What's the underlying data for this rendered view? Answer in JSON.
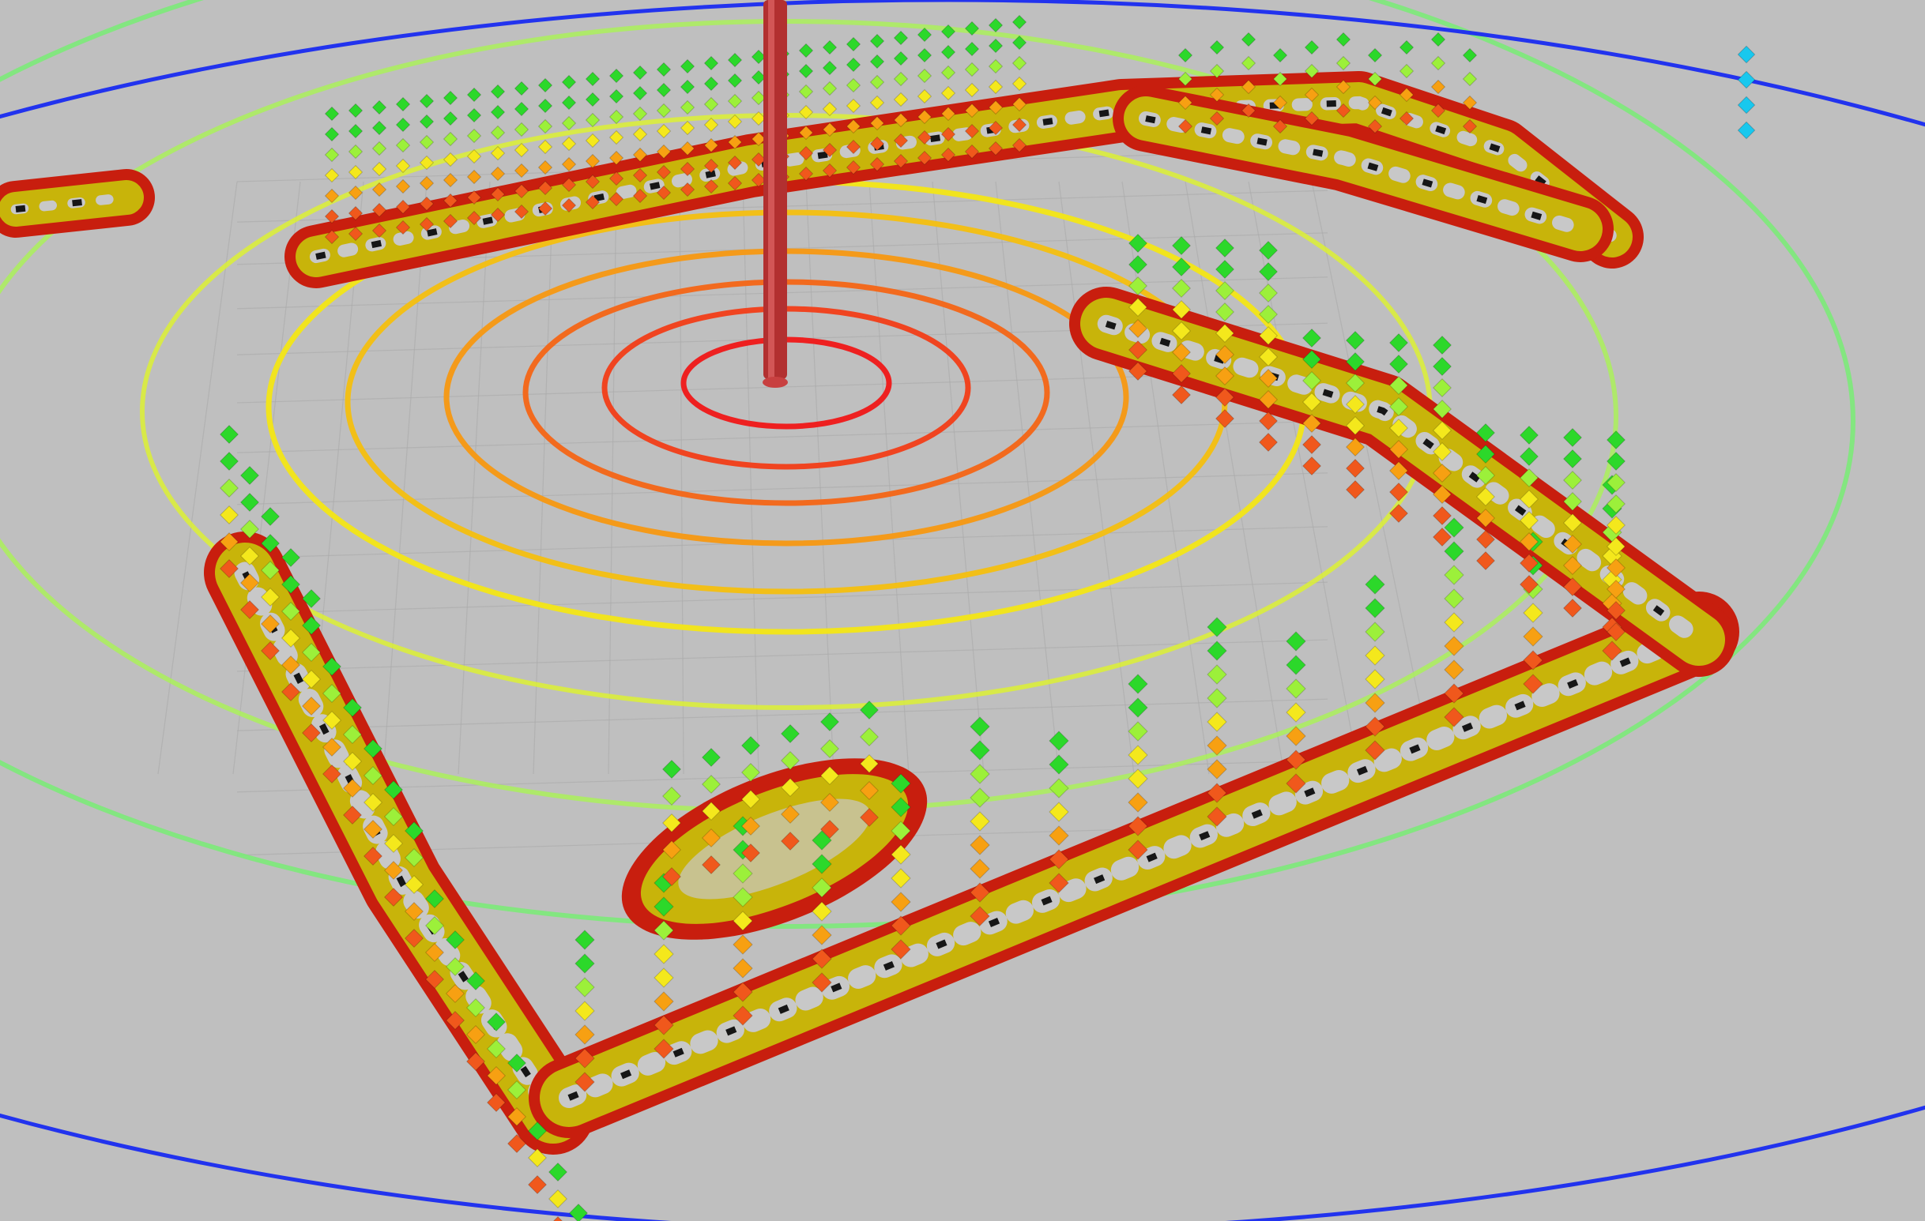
{
  "viewport": {
    "background": "#bfbfbf",
    "grid_color": "#a9a9a9",
    "costmap_colors": {
      "lethal": "#c81e0e",
      "inscribed": "#c8b40a",
      "free_cell": "#c8c8c8",
      "obstacle": "#161616"
    },
    "ring_colors": [
      "#ee2020",
      "#f04420",
      "#f26a1e",
      "#f49a1a",
      "#f2bf18",
      "#f1e41e",
      "#dcf034",
      "#aaf05a",
      "#78ec74"
    ],
    "outer_ring_color": "#2233ee",
    "pole_color": "#b23030",
    "voxel_colors": [
      "#f0581c",
      "#f7a012",
      "#f4e81c",
      "#9cf03a",
      "#2cd82a"
    ],
    "far_voxel_color": "#18c8ee"
  }
}
